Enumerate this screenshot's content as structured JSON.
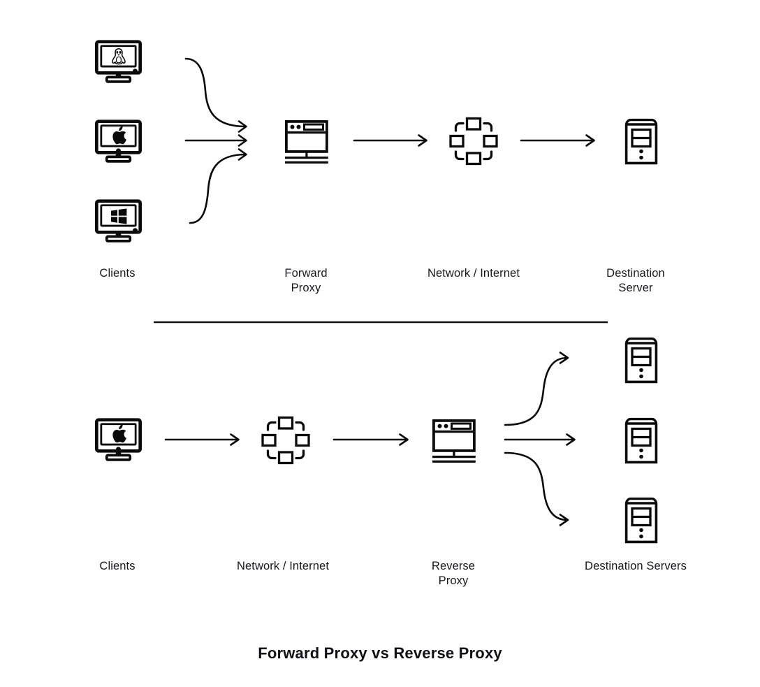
{
  "title": "Forward Proxy vs Reverse Proxy",
  "theme": {
    "background": "#ffffff",
    "stroke": "#0a0a0a",
    "text": "#16181c",
    "divider": "#111111"
  },
  "sections": [
    {
      "id": "forward-proxy-flow",
      "name": "Forward Proxy",
      "nodes": [
        {
          "id": "clients-top",
          "label": "Clients",
          "icon": "monitor-icon",
          "count": 3,
          "variants": [
            "linux-monitor-icon",
            "apple-monitor-icon",
            "windows-monitor-icon"
          ]
        },
        {
          "id": "forward-proxy",
          "label": "Forward\nProxy",
          "icon": "proxy-server-icon",
          "count": 1
        },
        {
          "id": "network-top",
          "label": "Network / Internet",
          "icon": "network-cloud-icon",
          "count": 1
        },
        {
          "id": "destination-server",
          "label": "Destination\nServer",
          "icon": "server-tower-icon",
          "count": 1
        }
      ],
      "connectors": [
        {
          "from": "clients-top",
          "to": "forward-proxy",
          "style": "converging",
          "arrows": 3
        },
        {
          "from": "forward-proxy",
          "to": "network-top",
          "style": "straight",
          "arrows": 1
        },
        {
          "from": "network-top",
          "to": "destination-server",
          "style": "straight",
          "arrows": 1
        }
      ]
    },
    {
      "id": "reverse-proxy-flow",
      "name": "Reverse Proxy",
      "nodes": [
        {
          "id": "clients-bottom",
          "label": "Clients",
          "icon": "apple-monitor-icon",
          "count": 1
        },
        {
          "id": "network-bottom",
          "label": "Network / Internet",
          "icon": "network-cloud-icon",
          "count": 1
        },
        {
          "id": "reverse-proxy",
          "label": "Reverse\nProxy",
          "icon": "proxy-server-icon",
          "count": 1
        },
        {
          "id": "destination-servers",
          "label": "Destination Servers",
          "icon": "server-tower-icon",
          "count": 3
        }
      ],
      "connectors": [
        {
          "from": "clients-bottom",
          "to": "network-bottom",
          "style": "straight",
          "arrows": 1
        },
        {
          "from": "network-bottom",
          "to": "reverse-proxy",
          "style": "straight",
          "arrows": 1
        },
        {
          "from": "reverse-proxy",
          "to": "destination-servers",
          "style": "diverging",
          "arrows": 3
        }
      ]
    }
  ],
  "labels": {
    "clients_top": "Clients",
    "forward_proxy": "Forward\nProxy",
    "network_top": "Network / Internet",
    "destination_server": "Destination\nServer",
    "clients_bottom": "Clients",
    "network_bottom": "Network / Internet",
    "reverse_proxy": "Reverse\nProxy",
    "destination_servers": "Destination Servers"
  }
}
